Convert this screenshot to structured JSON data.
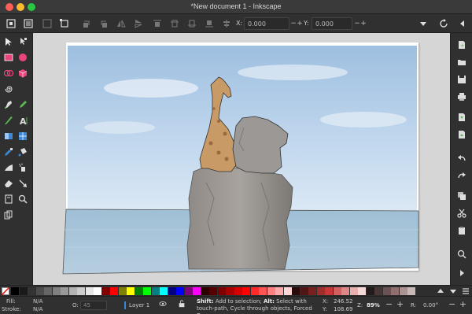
{
  "window": {
    "title": "*New document 1 - Inkscape"
  },
  "toolbar": {
    "x_label": "X:",
    "x_value": "0.000",
    "y_label": "Y:",
    "y_value": "0.000",
    "minus": "−",
    "plus": "+"
  },
  "status": {
    "fill_label": "Fill:",
    "fill_value": "N/A",
    "stroke_label": "Stroke:",
    "stroke_value": "N/A",
    "opacity_label": "O:",
    "opacity_value": "45",
    "layer_name": "Layer 1",
    "message_shift": "Shift:",
    "message_1": " Add to selection; ",
    "message_alt": "Alt:",
    "message_2": " Select with touch-path, Cycle through objects, Forced Drag",
    "x_label": "X:",
    "x_value": "246.52",
    "y_label": "Y:",
    "y_value": "108.69",
    "zoom_label": "Z:",
    "zoom_value": "89%",
    "rotate_label": "R:",
    "rotate_value": "0.00°"
  },
  "palette": {
    "colors": [
      "#000000",
      "#1a1a1a",
      "#333333",
      "#4d4d4d",
      "#666666",
      "#808080",
      "#999999",
      "#b3b3b3",
      "#cccccc",
      "#e6e6e6",
      "#ffffff",
      "#800000",
      "#ff0000",
      "#808000",
      "#ffff00",
      "#008000",
      "#00ff00",
      "#008080",
      "#00ffff",
      "#000080",
      "#0000ff",
      "#800080",
      "#ff00ff",
      "#2b0000",
      "#550000",
      "#800000",
      "#aa0000",
      "#d40000",
      "#ff0000",
      "#ff2a2a",
      "#ff5555",
      "#ff8080",
      "#ffaaaa",
      "#ffd5d5",
      "#280b0b",
      "#501616",
      "#782121",
      "#a02c2c",
      "#c83737",
      "#d35f5f",
      "#de8787",
      "#e9afaf",
      "#f4d7d7",
      "#241c1c",
      "#483737",
      "#6c5353",
      "#916f6f",
      "#ac9393",
      "#c8b7b7"
    ]
  }
}
